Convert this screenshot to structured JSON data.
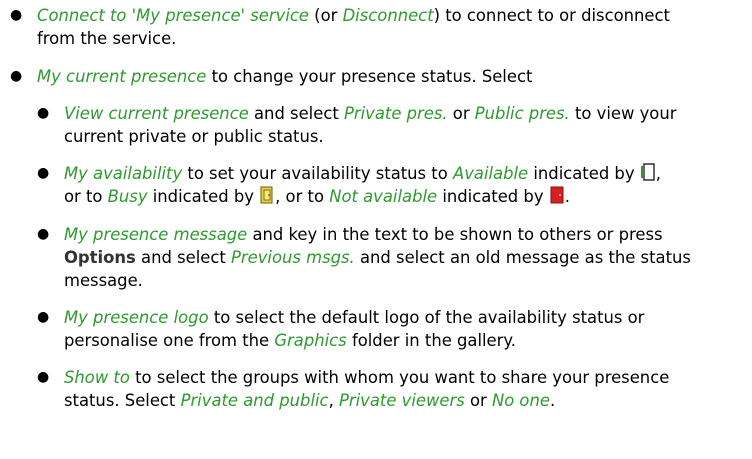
{
  "accent": "#2e9a2e",
  "items": [
    {
      "t1": "Connect to 'My presence' service",
      "t2": " (or ",
      "t3": "Disconnect",
      "t4": ") to connect to or disconnect",
      "t5": "from the service."
    },
    {
      "t1": "My current presence",
      "t2": " to change your presence status. Select"
    },
    {
      "t1": "View current presence",
      "t2": " and select ",
      "t3": "Private pres.",
      "t4": " or ",
      "t5": "Public pres.",
      "t6": " to view your",
      "t7": "current private or public status."
    },
    {
      "t1": "My availability",
      "t2": " to set your availability status to ",
      "t3": "Available",
      "t4": " indicated by ",
      "t5": ",",
      "t6": "or to ",
      "t7": "Busy",
      "t8": " indicated by ",
      "t9": ", or to ",
      "t10": "Not available",
      "t11": " indicated by ",
      "t12": "."
    },
    {
      "t1": "My presence message",
      "t2": " and key in the text to be shown to others or press",
      "t3": "Options",
      "t4": " and select ",
      "t5": "Previous msgs.",
      "t6": " and select an old message as the status",
      "t7": "message."
    },
    {
      "t1": "My presence logo",
      "t2": " to select the default logo of the availability status or",
      "t3": "personalise one from the ",
      "t4": "Graphics",
      "t5": " folder in the gallery."
    },
    {
      "t1": "Show to",
      "t2": " to select the groups with whom you want to share your presence",
      "t3": "status. Select ",
      "t4": "Private and public",
      "t5": ", ",
      "t6": "Private viewers",
      "t7": " or ",
      "t8": "No one",
      "t9": "."
    }
  ],
  "icons": [
    "available-icon",
    "busy-icon",
    "not-available-icon"
  ]
}
